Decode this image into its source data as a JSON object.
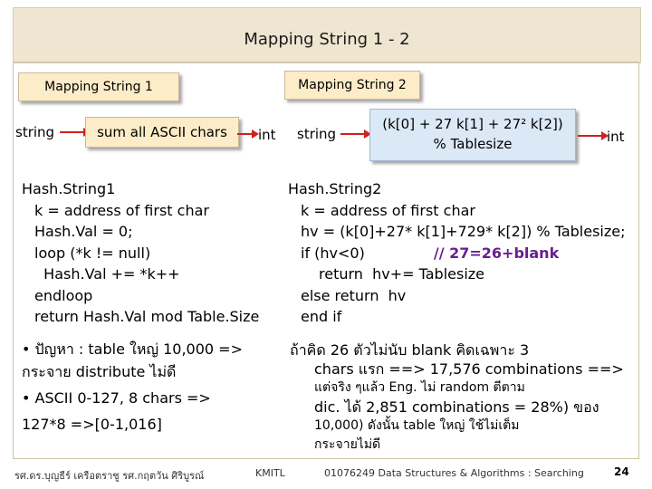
{
  "slide": {
    "title": "Mapping String 1 - 2",
    "page_number": "24"
  },
  "left": {
    "label": "Mapping String 1",
    "diagram": {
      "input": "string",
      "process": "sum all ASCII chars",
      "output": "int"
    },
    "code_title": "Hash.String1",
    "code_lines": [
      "k = address of first char",
      "Hash.Val = 0;",
      "loop (*k != null)",
      "  Hash.Val += *k++",
      "endloop",
      "return Hash.Val mod Table.Size"
    ],
    "bullet1_a": "• ปัญหา   : table ใหญ่    10,000 =>",
    "bullet1_b": "กระจาย distribute ไม่ดี",
    "bullet2_a": "• ASCII 0-127, 8 chars =>",
    "bullet2_b": "127*8 =>[0-1,016]"
  },
  "right": {
    "label": "Mapping String 2",
    "diagram": {
      "input": "string",
      "formula_line1": "(k[0] + 27 k[1] + 27² k[2])",
      "formula_line2": "% Tablesize",
      "output": "int"
    },
    "code_title": "Hash.String2",
    "code_lines": [
      "k = address of first char",
      "hv = (k[0]+27* k[1]+729* k[2]) % Tablesize;"
    ],
    "code_if": "if (hv<0)",
    "code_comment": "// 27=26+blank",
    "code_lines_after": [
      "return  hv+= Tablesize",
      "else return  hv",
      "end if"
    ],
    "text_lines": [
      "ถ้าคิด       26 ตัวไม่นับ           blank  คิดเฉพาะ   3",
      "chars แรก ==> 17,576 combinations ==>",
      "แต่จริง ๆแล้ว          Eng. ไม่   random  ตีตาม",
      "dic. ได้   2,851 combinations = 28%) ของ",
      "10,000) ดังนั้น         table ใหญ่    ใช้ไม่เต็ม",
      "กระจายไม่ดี"
    ]
  },
  "footer": {
    "author": "รศ.ดร.บุญธีร์      เครือตราชู       รศ.กฤตวัน   ศิริบูรณ์",
    "institute": "KMITL",
    "course": "01076249 Data Structures & Algorithms : Searching"
  }
}
